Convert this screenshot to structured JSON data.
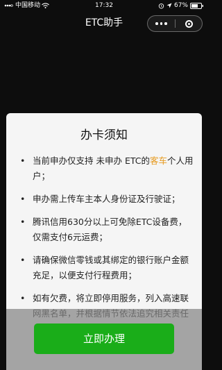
{
  "status_bar": {
    "carrier": "中国移动",
    "time": "17:32",
    "battery": "67%"
  },
  "nav": {
    "title": "ETC助手"
  },
  "dialog": {
    "title": "办卡须知",
    "items": [
      {
        "bullet": "•",
        "before": "当前申办仅支持 未申办 ETC的",
        "highlight": "客车",
        "after": "个人用户；"
      },
      {
        "bullet": "•",
        "text": "申办需上传车主本人身份证及行驶证；"
      },
      {
        "bullet": "•",
        "text": "腾讯信用630分以上可免除ETC设备费，仅需支付6元运费；"
      },
      {
        "bullet": "•",
        "text": "请确保微信零钱或其绑定的银行账户金额充足，以便支付行程费用；"
      },
      {
        "bullet": "•",
        "text": "如有欠费，将立即停用服务，列入高速联网黑名单，并根据情节依法追究相关责任"
      }
    ],
    "button_label": "立即办理"
  },
  "colors": {
    "accent": "#1aad19",
    "highlight": "#e69a1f"
  },
  "icons": [
    "signal-icon",
    "wifi-icon",
    "alarm-icon",
    "location-icon",
    "battery-icon",
    "more-icon",
    "close-miniprogram-icon"
  ]
}
